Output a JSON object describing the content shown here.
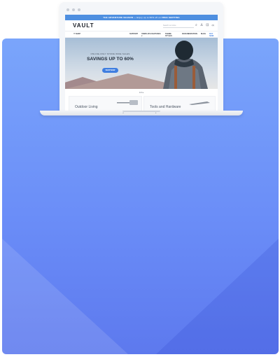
{
  "colors": {
    "card_top": "#7aa5fb",
    "card_bottom": "#5d79ee",
    "accent": "#3f7ee0",
    "announce_bar": "#4e8fe0"
  },
  "store": {
    "announcement": {
      "lead": "THE ADVENTURE SEASON",
      "middle": "— Enjoy up to 60% off on",
      "highlight": "FREE SHIPPING"
    },
    "logo": "VAULT",
    "search_placeholder": "Search our store",
    "cart_count": "(0)",
    "nav": {
      "shop_label": "☰ SHOP",
      "items": [
        "SUPPORT",
        "TEMPLATE FEATURES ▾",
        "THEME STYLES",
        "DOCUMENTATION",
        "BLOG",
        "BUY NOW"
      ]
    },
    "hero": {
      "eyebrow": "ONLINE-ONLY STORE WIDE SALES",
      "title": "SAVINGS UP TO 60%",
      "button": "SHOP NOW"
    },
    "carousel_indicator": "1/2 ▸",
    "categories": [
      "Outdoor Living",
      "Tools and Hardware"
    ]
  }
}
